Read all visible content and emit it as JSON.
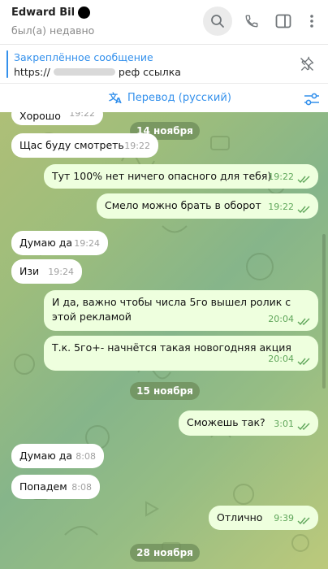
{
  "header": {
    "contact_name": "Edward Bil",
    "status": "был(а) недавно",
    "icons": [
      "search-icon",
      "phone-icon",
      "sidebar-toggle-icon",
      "more-vertical-icon"
    ]
  },
  "pinned": {
    "title": "Закреплённое сообщение",
    "text_prefix": "https://",
    "text_suffix": "реф ссылка",
    "icon": "unpin-icon"
  },
  "translate": {
    "label": "Перевод (русский)",
    "icon": "translate-icon",
    "settings_icon": "sliders-icon"
  },
  "colors": {
    "accent": "#3390ec",
    "outgoing_bubble": "#eeffde",
    "incoming_bubble": "#ffffff",
    "check_color": "#5fa65a"
  },
  "chat": {
    "dates": [
      "14 ноября",
      "15 ноября",
      "28 ноября"
    ],
    "messages": [
      {
        "dir": "in",
        "text": "Хорошо",
        "time": "19:22"
      },
      {
        "dir": "in",
        "text": "Щас буду смотреть",
        "time": "19:22"
      },
      {
        "dir": "out",
        "text": "Тут 100% нет ничего опасного для тебя)",
        "time": "19:22"
      },
      {
        "dir": "out",
        "text": "Смело можно брать в оборот",
        "time": "19:22"
      },
      {
        "dir": "in",
        "text": "Думаю да",
        "time": "19:24"
      },
      {
        "dir": "in",
        "text": "Изи",
        "time": "19:24"
      },
      {
        "dir": "out",
        "text": "И да, важно чтобы числа 5го вышел ролик с этой рекламой",
        "time": "20:04"
      },
      {
        "dir": "out",
        "text": "Т.к. 5го+- начнётся такая новогодняя акция",
        "time": "20:04"
      },
      {
        "dir": "out",
        "text": "Сможешь так?",
        "time": "3:01"
      },
      {
        "dir": "in",
        "text": "Думаю да",
        "time": "8:08"
      },
      {
        "dir": "in",
        "text": "Попадем",
        "time": "8:08"
      },
      {
        "dir": "out",
        "text": "Отлично",
        "time": "9:39"
      }
    ]
  }
}
